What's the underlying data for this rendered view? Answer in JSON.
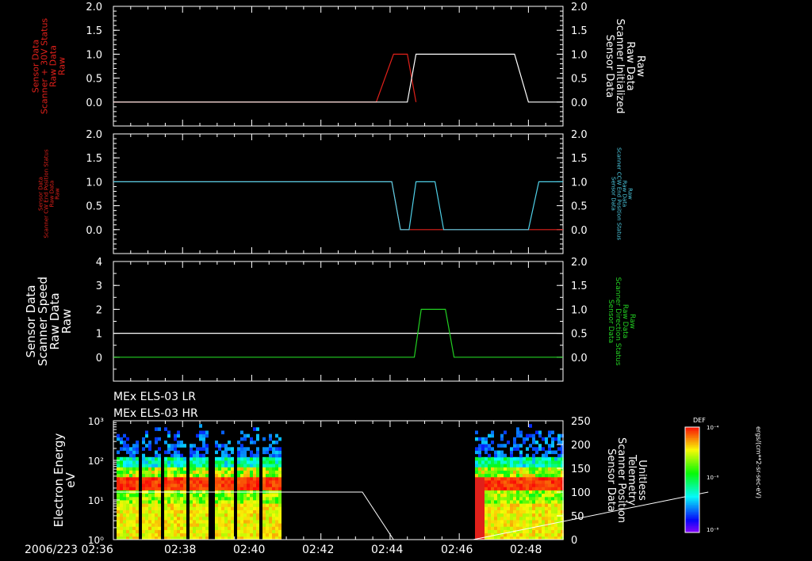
{
  "colors": {
    "white": "#ffffff",
    "red": "#e0201a",
    "cyan": "#4fd0e8",
    "green": "#22d022"
  },
  "panel_titles": [
    "MEx ELS-03 LR",
    "MEx ELS-03 HR"
  ],
  "time_axis": {
    "labels": [
      "2006/223 02:36",
      "02:38",
      "02:40",
      "02:42",
      "02:44",
      "02:46",
      "02:48"
    ]
  },
  "colorbar": {
    "title": "DEF",
    "ticks": [
      "10⁻⁴",
      "10⁻⁶",
      "10⁻⁸"
    ],
    "unit": "ergs/(cm**2-sr-sec-eV)"
  },
  "chart_data": [
    {
      "type": "line",
      "left_label": [
        "Sensor Data",
        "Scanner + 30V Status",
        "Raw Data",
        "Raw"
      ],
      "right_label": [
        "Sensor Data",
        "Scanner Initialized",
        "Raw Data",
        "Raw"
      ],
      "left_ticks": [
        "2.0",
        "1.5",
        "1.0",
        "0.5",
        "0.0"
      ],
      "right_ticks": [
        "2.0",
        "1.5",
        "1.0",
        "0.5",
        "0.0"
      ],
      "ylim": [
        -0.5,
        2.0
      ],
      "series": [
        {
          "color": "red",
          "x": [
            36.0,
            43.6,
            44.1,
            44.5,
            44.75
          ],
          "y": [
            0,
            0,
            1,
            1,
            0
          ]
        },
        {
          "color": "white",
          "x": [
            36.0,
            44.5,
            44.75,
            47.6,
            48.0,
            53.2
          ],
          "y": [
            0,
            0,
            1,
            1,
            0,
            0
          ]
        }
      ]
    },
    {
      "type": "line",
      "left_label": [
        "Sensor Data",
        "Scanner CW End Position Status",
        "Raw Data",
        "Raw"
      ],
      "right_label": [
        "Sensor Data",
        "Scanner CCW End Position Status",
        "Raw Data",
        "Raw"
      ],
      "left_ticks": [
        "2.0",
        "1.5",
        "1.0",
        "0.5",
        "0.0"
      ],
      "right_ticks": [
        "2.0",
        "1.5",
        "1.0",
        "0.5",
        "0.0"
      ],
      "ylim": [
        -0.5,
        2.0
      ],
      "series": [
        {
          "color": "red",
          "x": [
            36.0,
            44.05,
            44.3,
            44.55,
            45.25,
            45.55,
            53.2
          ],
          "y": [
            1,
            1,
            0,
            0,
            0,
            0,
            0
          ]
        },
        {
          "color": "cyan",
          "x": [
            36.0,
            44.05,
            44.3,
            44.55,
            44.75,
            45.3,
            45.55,
            48.0,
            48.3,
            53.2
          ],
          "y": [
            1,
            1,
            0,
            0,
            1,
            1,
            0,
            0,
            1,
            1
          ]
        }
      ]
    },
    {
      "type": "line",
      "left_label": [
        "Sensor Data",
        "Scanner Speed",
        "Raw Data",
        "Raw"
      ],
      "right_label": [
        "Sensor Data",
        "Scanner Direction Status",
        "Raw Data",
        "Raw"
      ],
      "left_ticks": [
        "4",
        "3",
        "2",
        "1",
        "0"
      ],
      "right_ticks": [
        "2.0",
        "1.5",
        "1.0",
        "0.5",
        "0.0"
      ],
      "ylim": [
        -1,
        4
      ],
      "series": [
        {
          "color": "white",
          "x": [
            36.0,
            53.2
          ],
          "y": [
            1,
            1
          ]
        },
        {
          "color": "green",
          "x": [
            36.0,
            44.7,
            44.9,
            45.6,
            45.85,
            53.2
          ],
          "y": [
            0,
            0,
            2,
            2,
            0,
            0
          ]
        }
      ]
    },
    {
      "type": "heatmap",
      "left_label": [
        "Electron Energy",
        "eV"
      ],
      "right_label": [
        "Sensor Data",
        "Scanner Position",
        "Telemetry",
        "Unitless"
      ],
      "left_ticks": [
        "10³",
        "10²",
        "10¹",
        "10⁰"
      ],
      "right_ticks": [
        "250",
        "200",
        "150",
        "100",
        "50",
        "0"
      ],
      "ylim_log": [
        0,
        3
      ],
      "y2lim": [
        0,
        250
      ],
      "data_gap": [
        40.8,
        46.4
      ],
      "overlay_series": {
        "color": "white",
        "x": [
          36.0,
          42.3,
          42.6,
          43.2,
          44.1,
          44.35,
          44.55,
          45.4,
          45.9,
          46.15,
          46.4,
          53.2
        ],
        "y": [
          100,
          100,
          100,
          100,
          0,
          0,
          0,
          0,
          0,
          0,
          0,
          100
        ]
      }
    }
  ]
}
